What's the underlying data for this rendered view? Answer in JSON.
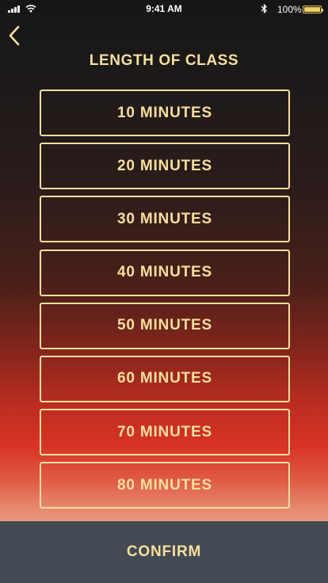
{
  "status_bar": {
    "time": "9:41 AM",
    "battery_percent": "100%",
    "battery_level": 1.0,
    "signal_icon": "cellular-signal-icon",
    "wifi_icon": "wifi-icon",
    "bluetooth_icon": "bluetooth-icon",
    "battery_icon": "battery-icon"
  },
  "header": {
    "back_icon": "chevron-left-icon",
    "title": "LENGTH OF CLASS"
  },
  "options": [
    {
      "label": "10 MINUTES"
    },
    {
      "label": "20 MINUTES"
    },
    {
      "label": "30 MINUTES"
    },
    {
      "label": "40 MINUTES"
    },
    {
      "label": "50 MINUTES"
    },
    {
      "label": "60 MINUTES"
    },
    {
      "label": "70 MINUTES"
    },
    {
      "label": "80 MINUTES"
    }
  ],
  "footer": {
    "confirm_label": "CONFIRM"
  },
  "colors": {
    "accent": "#f7df9c",
    "footer_background": "#444a53",
    "gradient_top": "#161616",
    "gradient_red": "#d83427",
    "gradient_bottom": "#e89a7f"
  }
}
